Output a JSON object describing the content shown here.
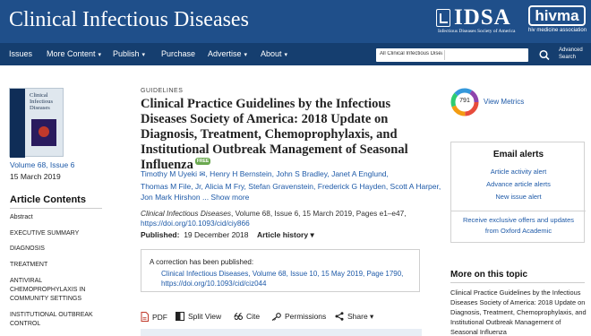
{
  "header": {
    "journal_title": "Clinical Infectious Diseases",
    "idsa_logo": "IDSA",
    "idsa_subtitle": "Infectious Diseases Society of America",
    "hivma_logo": "hivma",
    "hivma_subtitle": "hiv medicine association"
  },
  "nav": {
    "items": [
      {
        "label": "Issues",
        "dropdown": false
      },
      {
        "label": "More Content",
        "dropdown": true
      },
      {
        "label": "Publish",
        "dropdown": true
      },
      {
        "label": "Purchase",
        "dropdown": false
      },
      {
        "label": "Advertise",
        "dropdown": true
      },
      {
        "label": "About",
        "dropdown": true
      }
    ],
    "caret": "▾",
    "search_scope": "All Clinical Infectious Diseases",
    "search_icon": "magnifier-icon",
    "advanced_line1": "Advanced",
    "advanced_line2": "Search"
  },
  "sidebar": {
    "cover_title_line1": "Clinical",
    "cover_title_line2": "Infectious",
    "cover_title_line3": "Diseases",
    "issue": "Volume 68, Issue 6",
    "date": "15 March 2019",
    "contents_heading": "Article Contents",
    "contents": [
      "Abstract",
      "EXECUTIVE SUMMARY",
      "DIAGNOSIS",
      "TREATMENT",
      "ANTIVIRAL",
      "CHEMOPROPHYLAXIS IN",
      "COMMUNITY SETTINGS",
      "INSTITUTIONAL OUTBREAK",
      "CONTROL"
    ]
  },
  "article": {
    "kicker": "GUIDELINES",
    "title": "Clinical Practice Guidelines by the Infectious Diseases Society of America: 2018 Update on Diagnosis, Treatment, Chemoprophylaxis, and Institutional Outbreak Management of Seasonal Influenza",
    "free_badge": "FREE",
    "authors_line1": "Timothy M Uyeki ✉, Henry H Bernstein, John S Bradley, Janet A Englund,",
    "authors_line2": "Thomas M File, Jr, Alicia M Fry, Stefan Gravenstein, Frederick G Hayden, Scott A Harper,",
    "authors_line3": "Jon Mark Hirshon ... Show more",
    "citation_journal": "Clinical Infectious Diseases",
    "citation_rest": ", Volume 68, Issue 6, 15 March 2019, Pages e1–e47,",
    "doi": "https://doi.org/10.1093/cid/ciy866",
    "published_label": "Published:",
    "published_date": "19 December 2018",
    "history_label": "Article history ▾",
    "correction_text": "A correction has been published:",
    "correction_cite_line1": "Clinical Infectious Diseases, Volume 68, Issue 10, 15 May 2019, Page 1790,",
    "correction_cite_line2": "https://doi.org/10.1093/cid/ciz044"
  },
  "toolbar": {
    "pdf": "PDF",
    "split_view": "Split View",
    "cite": "Cite",
    "permissions": "Permissions",
    "share": "Share ▾"
  },
  "right": {
    "altmetric_score": "791",
    "view_metrics": "View Metrics",
    "alerts_heading": "Email alerts",
    "alerts_links": [
      "Article activity alert",
      "Advance article alerts",
      "New issue alert"
    ],
    "offer_line1": "Receive exclusive offers and updates",
    "offer_line2": "from Oxford Academic",
    "more_heading": "More on this topic",
    "more_item": "Clinical Practice Guidelines by the Infectious Diseases Society of America: 2018 Update on Diagnosis, Treatment, Chemoprophylaxis, and Institutional Outbreak Management of Seasonal Influenza"
  },
  "colors": {
    "header_blue": "#1f4f8a",
    "nav_blue": "#153e6f",
    "link_blue": "#1e5aa8",
    "free_green": "#6aa84f"
  }
}
